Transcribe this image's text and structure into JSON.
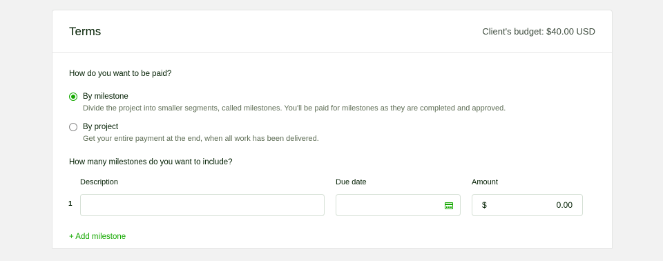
{
  "header": {
    "title": "Terms",
    "budget": "Client's budget: $40.00 USD"
  },
  "payment": {
    "question": "How do you want to be paid?",
    "options": [
      {
        "label": "By milestone",
        "description": "Divide the project into smaller segments, called milestones. You'll be paid for milestones as they are completed and approved.",
        "selected": true
      },
      {
        "label": "By project",
        "description": "Get your entire payment at the end, when all work has been delivered.",
        "selected": false
      }
    ]
  },
  "milestones": {
    "question": "How many milestones do you want to include?",
    "columns": {
      "description": "Description",
      "due_date": "Due date",
      "amount": "Amount"
    },
    "rows": [
      {
        "number": "1",
        "description": "",
        "due_date": "",
        "currency": "$",
        "amount": "0.00"
      }
    ],
    "add_label": "+ Add milestone"
  },
  "colors": {
    "accent": "#14a800",
    "text": "#001e00",
    "muted": "#5e6d55",
    "border": "#e4e5e4"
  },
  "icons": {
    "due_date_icon": "calendar-icon"
  }
}
